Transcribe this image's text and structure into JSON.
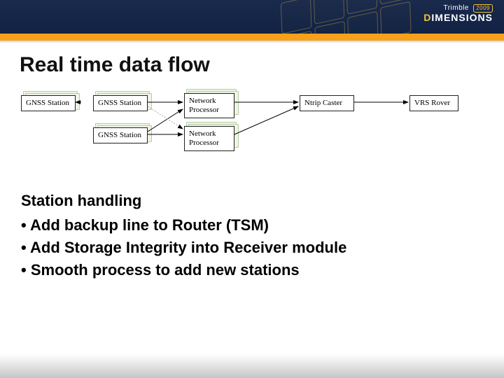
{
  "brand": {
    "company": "Trimble",
    "event": "DIMENSIONS",
    "event_accent_after": "D",
    "year": "2009"
  },
  "title": "Real time data flow",
  "diagram": {
    "nodes": {
      "gnss1": "GNSS Station",
      "gnss2": "GNSS Station",
      "gnss3": "GNSS Station",
      "np1": "Network\nProcessor",
      "np2": "Network\nProcessor",
      "caster": "Ntrip Caster",
      "rover": "VRS Rover"
    }
  },
  "section": {
    "heading": "Station handling",
    "bullets": [
      "Add backup line to Router (TSM)",
      "Add Storage Integrity into Receiver module",
      "Smooth process to add new stations"
    ]
  }
}
